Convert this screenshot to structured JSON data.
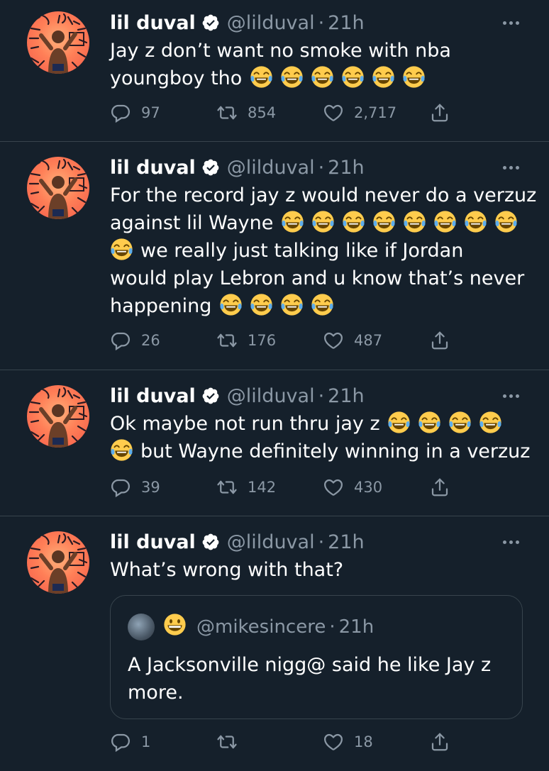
{
  "tweets": [
    {
      "name": "lil duval",
      "handle": "@lilduval",
      "separator": "·",
      "time": "21h",
      "lines": [
        {
          "text": "Jay z don’t want no smoke with nba",
          "emoji_before": 0,
          "emoji_after": 0
        },
        {
          "text": "youngboy tho",
          "emoji_before": 0,
          "emoji_after": 6
        }
      ],
      "replies": "97",
      "retweets": "854",
      "likes": "2,717"
    },
    {
      "name": "lil duval",
      "handle": "@lilduval",
      "separator": "·",
      "time": "21h",
      "lines": [
        {
          "text": "For the record jay z would never do a verzuz",
          "emoji_before": 0,
          "emoji_after": 0
        },
        {
          "text": "against lil Wayne",
          "emoji_before": 0,
          "emoji_after": 8
        },
        {
          "text": "we really just talking like if Jordan",
          "emoji_before": 1,
          "emoji_after": 0
        },
        {
          "text": "would play Lebron and u know that’s never",
          "emoji_before": 0,
          "emoji_after": 0
        },
        {
          "text": "happening",
          "emoji_before": 0,
          "emoji_after": 4
        }
      ],
      "replies": "26",
      "retweets": "176",
      "likes": "487"
    },
    {
      "name": "lil duval",
      "handle": "@lilduval",
      "separator": "·",
      "time": "21h",
      "lines": [
        {
          "text": "Ok maybe not run thru jay z",
          "emoji_before": 0,
          "emoji_after": 4
        },
        {
          "text": "but Wayne definitely winning in a verzuz",
          "emoji_before": 1,
          "emoji_after": 0
        }
      ],
      "replies": "39",
      "retweets": "142",
      "likes": "430"
    },
    {
      "name": "lil duval",
      "handle": "@lilduval",
      "separator": "·",
      "time": "21h",
      "lines": [
        {
          "text": "What’s wrong with that?",
          "emoji_before": 0,
          "emoji_after": 0
        }
      ],
      "quote": {
        "handle": "@mikesincere",
        "separator": "·",
        "time": "21h",
        "lines": [
          "A Jacksonville nigg@ said he like Jay z",
          "more."
        ]
      },
      "replies": "1",
      "retweets": "",
      "likes": "18"
    }
  ],
  "icons": {
    "reply": "reply-icon",
    "retweet": "retweet-icon",
    "like": "like-icon",
    "share": "share-icon",
    "verified": "verified-badge-icon",
    "more": "more-icon",
    "emoji": "joy-emoji"
  },
  "colors": {
    "background": "#15202b",
    "text": "#ffffff",
    "muted": "#8b98a5",
    "border": "#38444d"
  }
}
